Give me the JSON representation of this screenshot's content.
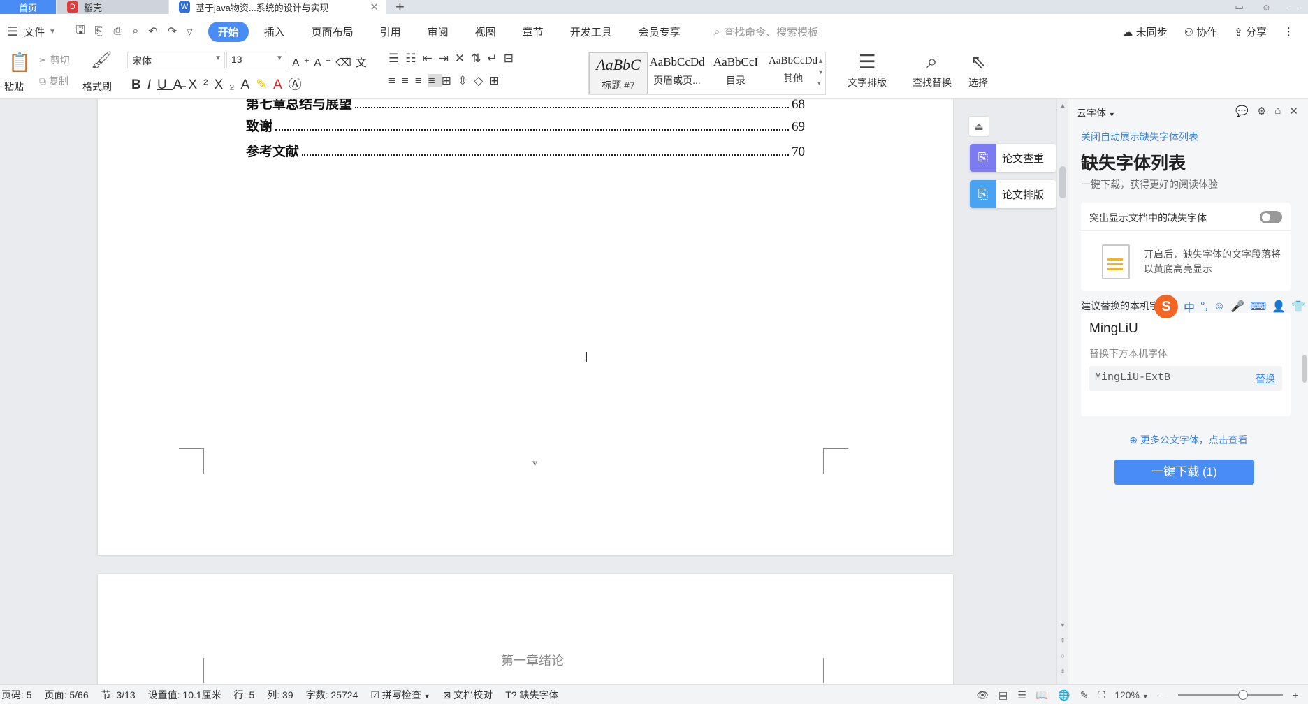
{
  "tabs": {
    "home": "首页",
    "daoke": "稻壳",
    "doc": "基于java物资...系统的设计与实现"
  },
  "menu": {
    "file": "文件",
    "tabs": [
      "开始",
      "插入",
      "页面布局",
      "引用",
      "审阅",
      "视图",
      "章节",
      "开发工具",
      "会员专享"
    ],
    "search_placeholder": "查找命令、搜索模板",
    "right": [
      "未同步",
      "协作",
      "分享"
    ]
  },
  "ribbon": {
    "paste": "粘贴",
    "cut": "剪切",
    "copy": "复制",
    "format_painter": "格式刷",
    "font_name": "宋体",
    "font_size": "13",
    "styles": [
      {
        "sample": "AaBbC",
        "name": "标题 #7"
      },
      {
        "sample": "AaBbCcDd",
        "name": "页眉或页..."
      },
      {
        "sample": "AaBbCcI",
        "name": "目录"
      },
      {
        "sample": "AaBbCcDd",
        "name": "其他"
      }
    ],
    "text_layout": "文字排版",
    "find_replace": "查找替换",
    "select": "选择"
  },
  "document": {
    "toc": [
      {
        "title": "第七章总结与展望",
        "page": "68"
      },
      {
        "title": "致谢",
        "page": "69"
      },
      {
        "title": "参考文献",
        "page": "70"
      }
    ],
    "page_footer": "v",
    "next_page_header": "第一章绪论"
  },
  "float_buttons": {
    "check": "论文查重",
    "format": "论文排版"
  },
  "panel": {
    "header": "云字体",
    "close_link": "关闭自动展示缺失字体列表",
    "title": "缺失字体列表",
    "subtitle": "一键下载，获得更好的阅读体验",
    "highlight_label": "突出显示文档中的缺失字体",
    "highlight_desc": "开启后，缺失字体的文字段落将以黄底高亮显示",
    "suggest_label": "建议替换的本机字",
    "missing_font": "MingLiU",
    "replace_hint": "替换下方本机字体",
    "replacement_font": "MingLiU-ExtB",
    "replace_action": "替换",
    "more_link": "更多公文字体，点击查看",
    "download_button": "一键下载 (1)"
  },
  "ime": {
    "mode": "中",
    "punct": "°,"
  },
  "status": {
    "page_code": "页码: 5",
    "page": "页面: 5/66",
    "section": "节: 3/13",
    "setting": "设置值: 10.1厘米",
    "row": "行: 5",
    "col": "列: 39",
    "words": "字数: 25724",
    "spell": "拼写检查",
    "proof": "文档校对",
    "missing_font": "缺失字体",
    "zoom": "120%"
  }
}
